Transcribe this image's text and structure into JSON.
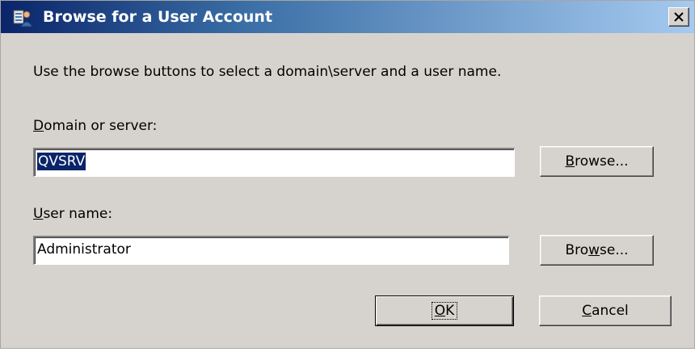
{
  "window": {
    "title": "Browse for a User Account",
    "icon": "user-account-icon",
    "close_icon": "close-icon"
  },
  "dialog": {
    "instructions": "Use the browse buttons to select a domain\\server and a user name.",
    "domain": {
      "label_access_key": "D",
      "label_rest": "omain or server:",
      "value": "QVSRV",
      "value_selected": true,
      "browse_label_access_key": "B",
      "browse_label_rest": "rowse..."
    },
    "user": {
      "label_access_key": "U",
      "label_rest": "ser name:",
      "value": "Administrator",
      "browse_label_prefix": "Bro",
      "browse_label_access_key": "w",
      "browse_label_rest": "se..."
    },
    "buttons": {
      "ok_access_key": "O",
      "ok_rest": "K",
      "cancel_access_key": "C",
      "cancel_rest": "ancel"
    }
  },
  "colors": {
    "dialog_face": "#d6d3ce",
    "titlebar_start": "#0a246a",
    "titlebar_end": "#a6caf0",
    "selection": "#0a246a"
  }
}
